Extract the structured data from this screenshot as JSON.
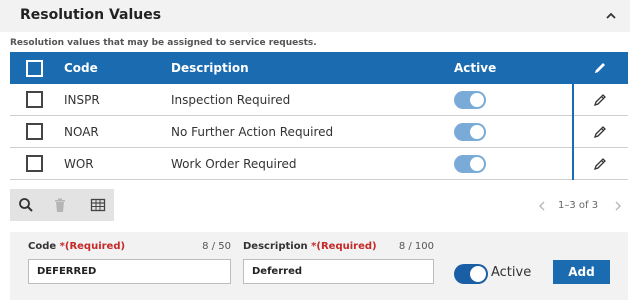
{
  "header": {
    "title": "Resolution Values"
  },
  "subtitle": "Resolution values that may be assigned to service requests.",
  "grid": {
    "columns": {
      "code": "Code",
      "description": "Description",
      "active": "Active"
    },
    "rows": [
      {
        "code": "INSPR",
        "description": "Inspection Required",
        "active": true
      },
      {
        "code": "NOAR",
        "description": "No Further Action Required",
        "active": true
      },
      {
        "code": "WOR",
        "description": "Work Order Required",
        "active": true
      }
    ]
  },
  "pager": {
    "text": "1–3 of 3"
  },
  "form": {
    "code": {
      "label": "Code",
      "required": "*(Required)",
      "count": "8 / 50",
      "value": "DEFERRED"
    },
    "description": {
      "label": "Description",
      "required": "*(Required)",
      "count": "8 / 100",
      "value": "Deferred"
    },
    "active_label": "Active",
    "add_label": "Add"
  },
  "colors": {
    "accent": "#1a6bb0",
    "toggle_on": "#7aabd6",
    "required": "#c62828"
  }
}
